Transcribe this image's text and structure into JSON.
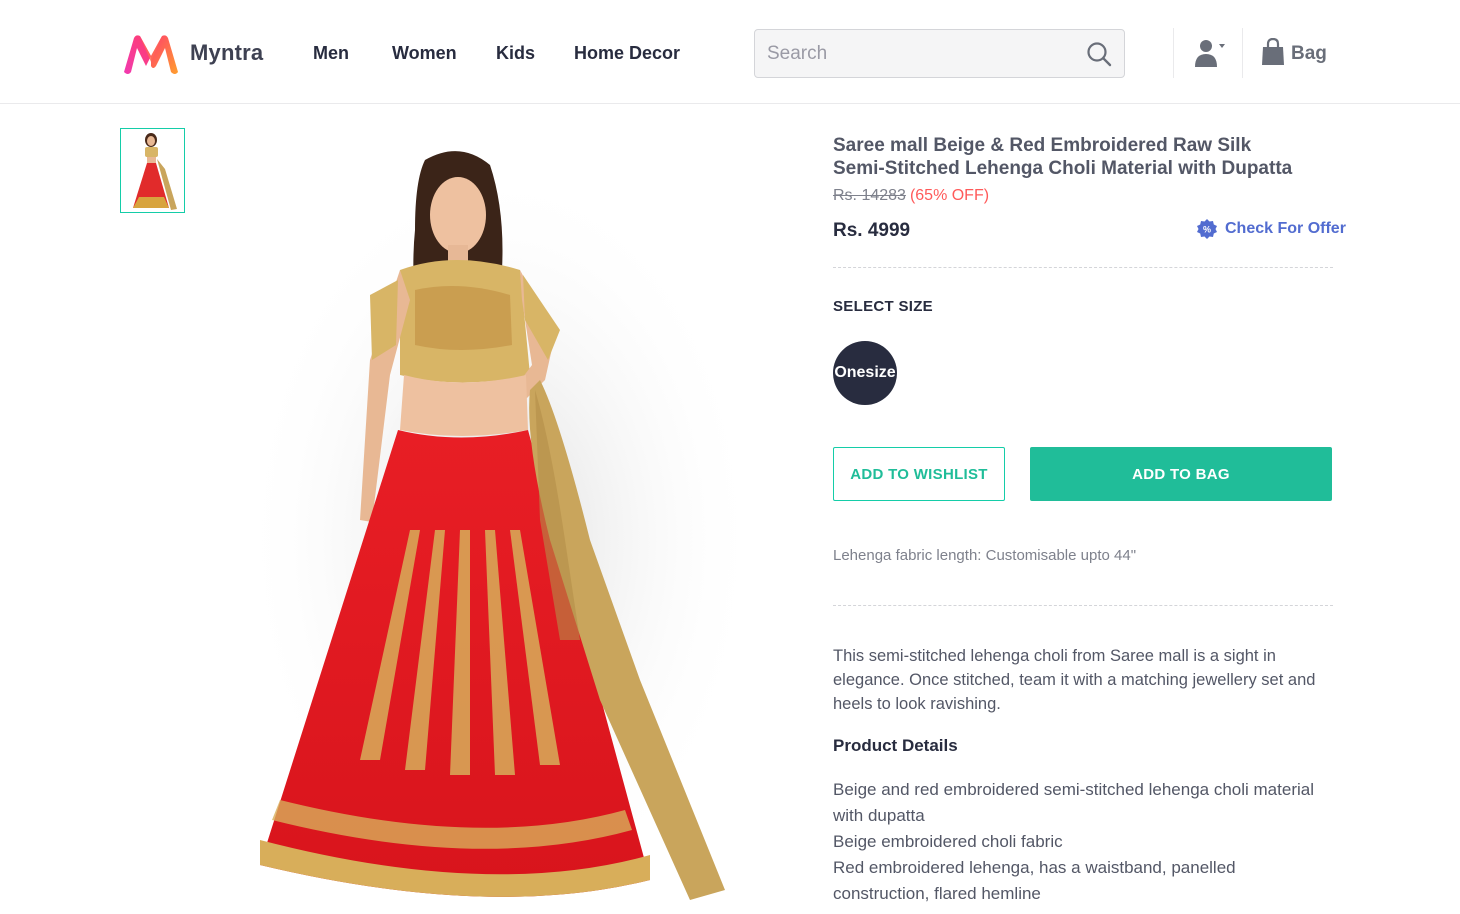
{
  "header": {
    "brand": "Myntra",
    "nav": [
      "Men",
      "Women",
      "Kids",
      "Home Decor"
    ],
    "search_placeholder": "Search",
    "bag_label": "Bag"
  },
  "product": {
    "title": "Saree mall Beige & Red Embroidered Raw Silk Semi-Stitched Lehenga Choli Material with Dupatta",
    "mrp": "Rs. 14283",
    "discount": "(65% OFF)",
    "price": "Rs. 4999",
    "offer_label": "Check For Offer",
    "select_size_label": "SELECT SIZE",
    "sizes": [
      "Onesize"
    ],
    "wishlist_label": "ADD TO WISHLIST",
    "add_to_bag_label": "ADD TO BAG",
    "fabric_note": "Lehenga fabric length: Customisable upto 44\"",
    "description": "This semi-stitched lehenga choli from Saree mall is a sight in elegance. Once stitched, team it with a matching jewellery set and heels to look ravishing.",
    "details_heading": "Product Details",
    "details": [
      "Beige and red embroidered semi-stitched lehenga choli material with dupatta",
      "Beige embroidered choli fabric",
      "Red embroidered lehenga, has a waistband, panelled construction, flared hemline"
    ]
  },
  "colors": {
    "accent": "#20bd99",
    "discount": "#ff5a5a",
    "offer": "#526cd0",
    "brand_pink": "#ff3f6c",
    "brand_orange": "#ff9f2e"
  }
}
